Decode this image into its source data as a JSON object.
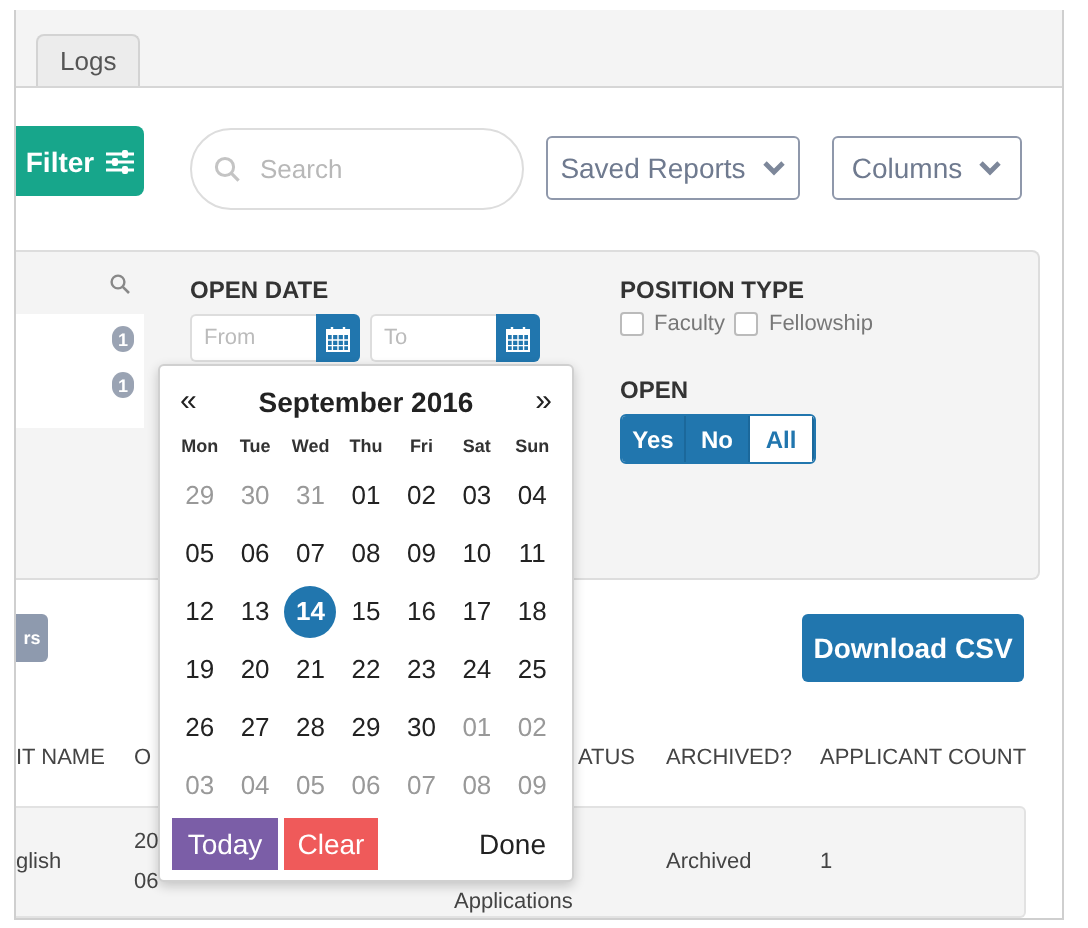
{
  "tabs": [
    {
      "label": "Logs",
      "selected": false
    }
  ],
  "toolbar": {
    "filter_button": "Filter",
    "search": {
      "placeholder": "Search"
    },
    "saved_reports": "Saved Reports",
    "columns": "Columns"
  },
  "filter_panel": {
    "list_badges": [
      "1",
      "1"
    ],
    "open_date": {
      "label": "OPEN DATE",
      "from": {
        "placeholder": "From"
      },
      "to": {
        "placeholder": "To"
      }
    },
    "position_type": {
      "label": "POSITION TYPE",
      "options": [
        {
          "label": "Faculty",
          "checked": false
        },
        {
          "label": "Fellowship",
          "checked": false
        }
      ]
    },
    "open": {
      "label": "OPEN",
      "options": [
        {
          "label": "Yes",
          "selected": false
        },
        {
          "label": "No",
          "selected": false
        },
        {
          "label": "All",
          "selected": true
        }
      ]
    }
  },
  "partial_button": "rs",
  "download_button": "Download CSV",
  "table": {
    "columns": [
      "IT NAME",
      "O",
      "ATUS",
      "ARCHIVED?",
      "APPLICANT COUNT"
    ],
    "rows": [
      {
        "name": "glish",
        "date_lines": [
          "20",
          "06"
        ],
        "status": "Applications",
        "archived": "Archived",
        "count": "1"
      }
    ]
  },
  "datepicker": {
    "prev": "«",
    "title": "September 2016",
    "next": "»",
    "weekdays": [
      "Mon",
      "Tue",
      "Wed",
      "Thu",
      "Fri",
      "Sat",
      "Sun"
    ],
    "weeks": [
      [
        {
          "day": "29",
          "outside": true,
          "selected": false
        },
        {
          "day": "30",
          "outside": true,
          "selected": false
        },
        {
          "day": "31",
          "outside": true,
          "selected": false
        },
        {
          "day": "01",
          "outside": false,
          "selected": false
        },
        {
          "day": "02",
          "outside": false,
          "selected": false
        },
        {
          "day": "03",
          "outside": false,
          "selected": false
        },
        {
          "day": "04",
          "outside": false,
          "selected": false
        }
      ],
      [
        {
          "day": "05",
          "outside": false,
          "selected": false
        },
        {
          "day": "06",
          "outside": false,
          "selected": false
        },
        {
          "day": "07",
          "outside": false,
          "selected": false
        },
        {
          "day": "08",
          "outside": false,
          "selected": false
        },
        {
          "day": "09",
          "outside": false,
          "selected": false
        },
        {
          "day": "10",
          "outside": false,
          "selected": false
        },
        {
          "day": "11",
          "outside": false,
          "selected": false
        }
      ],
      [
        {
          "day": "12",
          "outside": false,
          "selected": false
        },
        {
          "day": "13",
          "outside": false,
          "selected": false
        },
        {
          "day": "14",
          "outside": false,
          "selected": true
        },
        {
          "day": "15",
          "outside": false,
          "selected": false
        },
        {
          "day": "16",
          "outside": false,
          "selected": false
        },
        {
          "day": "17",
          "outside": false,
          "selected": false
        },
        {
          "day": "18",
          "outside": false,
          "selected": false
        }
      ],
      [
        {
          "day": "19",
          "outside": false,
          "selected": false
        },
        {
          "day": "20",
          "outside": false,
          "selected": false
        },
        {
          "day": "21",
          "outside": false,
          "selected": false
        },
        {
          "day": "22",
          "outside": false,
          "selected": false
        },
        {
          "day": "23",
          "outside": false,
          "selected": false
        },
        {
          "day": "24",
          "outside": false,
          "selected": false
        },
        {
          "day": "25",
          "outside": false,
          "selected": false
        }
      ],
      [
        {
          "day": "26",
          "outside": false,
          "selected": false
        },
        {
          "day": "27",
          "outside": false,
          "selected": false
        },
        {
          "day": "28",
          "outside": false,
          "selected": false
        },
        {
          "day": "29",
          "outside": false,
          "selected": false
        },
        {
          "day": "30",
          "outside": false,
          "selected": false
        },
        {
          "day": "01",
          "outside": true,
          "selected": false
        },
        {
          "day": "02",
          "outside": true,
          "selected": false
        }
      ],
      [
        {
          "day": "03",
          "outside": true,
          "selected": false
        },
        {
          "day": "04",
          "outside": true,
          "selected": false
        },
        {
          "day": "05",
          "outside": true,
          "selected": false
        },
        {
          "day": "06",
          "outside": true,
          "selected": false
        },
        {
          "day": "07",
          "outside": true,
          "selected": false
        },
        {
          "day": "08",
          "outside": true,
          "selected": false
        },
        {
          "day": "09",
          "outside": true,
          "selected": false
        }
      ]
    ],
    "buttons": {
      "today": "Today",
      "clear": "Clear",
      "done": "Done"
    }
  }
}
